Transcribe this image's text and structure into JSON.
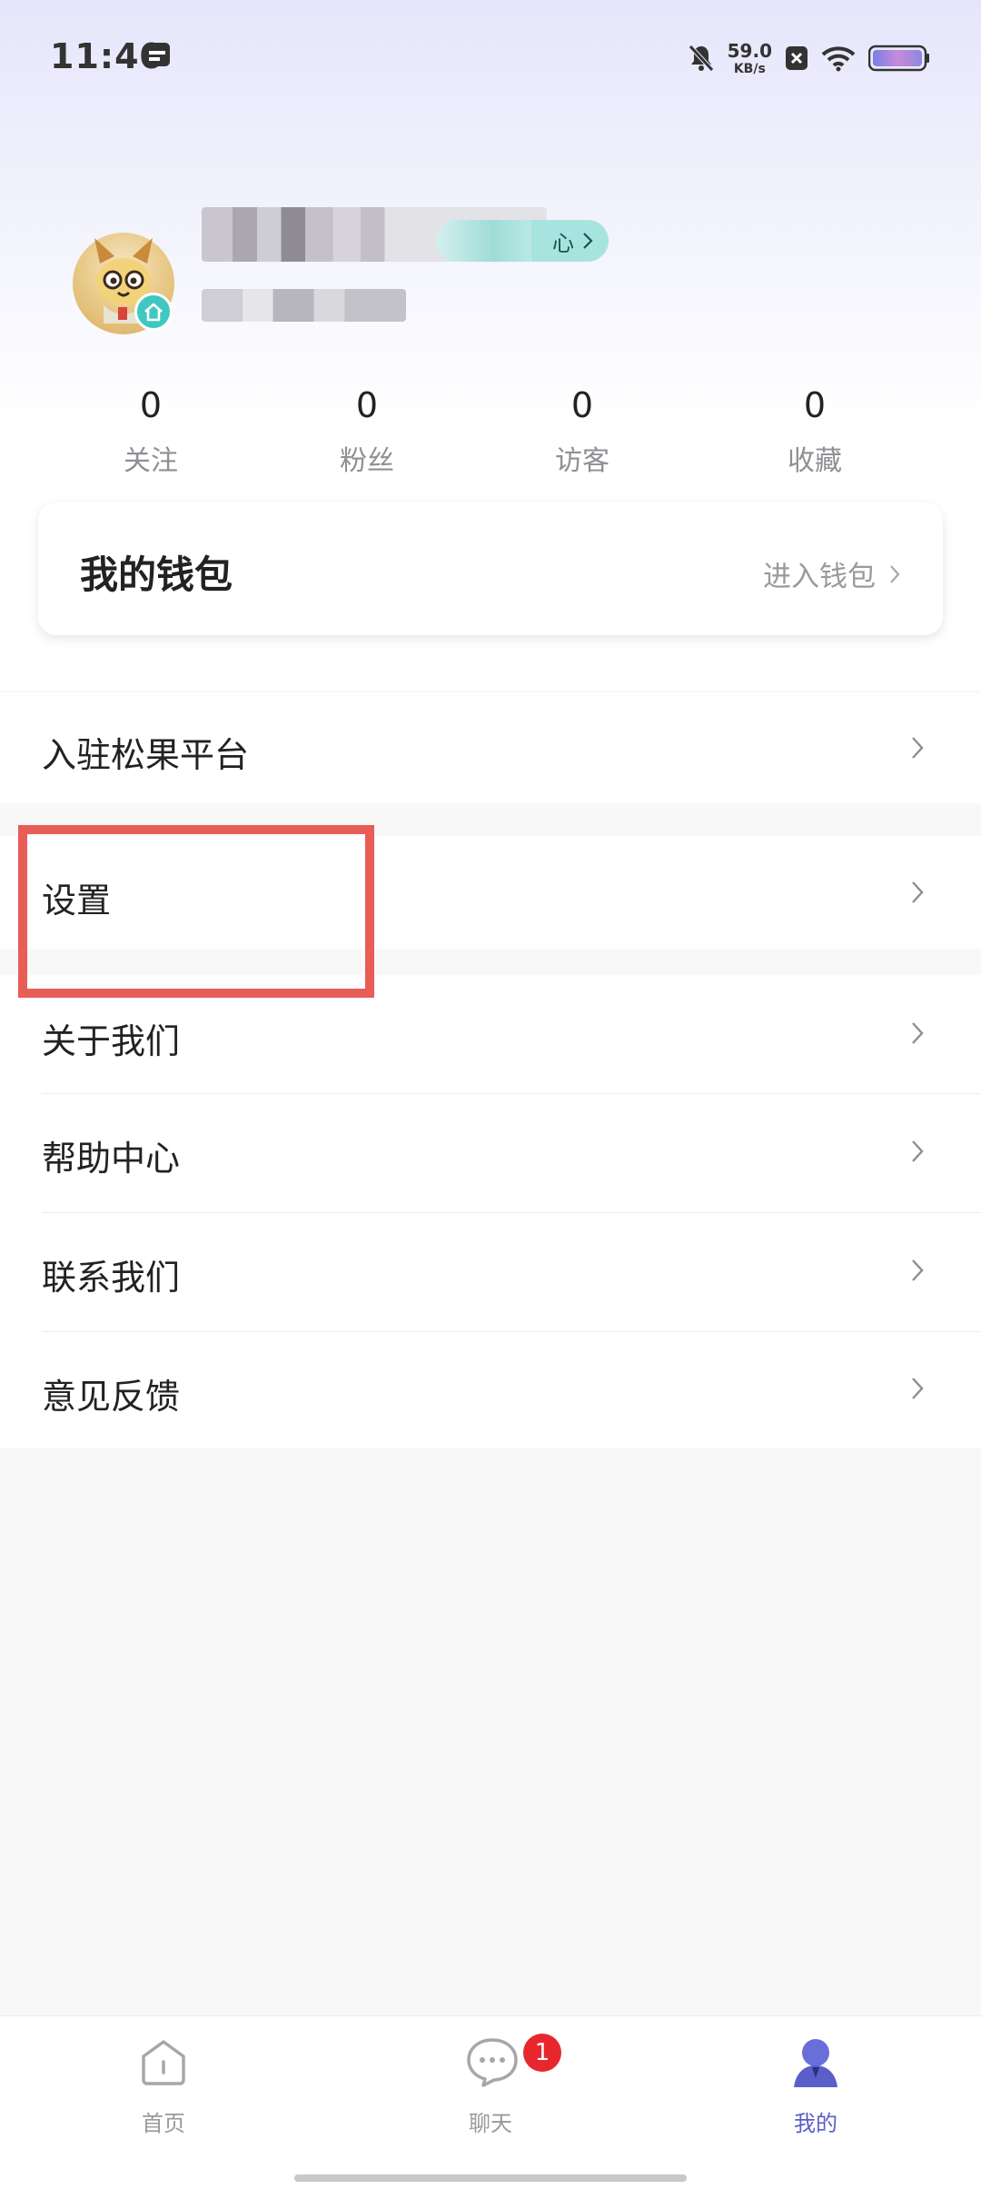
{
  "status": {
    "time": "11:40",
    "net_speed_value": "59.0",
    "net_speed_unit": "KB/s"
  },
  "profile": {
    "member_pill": "心"
  },
  "stats": [
    {
      "value": "0",
      "label": "关注"
    },
    {
      "value": "0",
      "label": "粉丝"
    },
    {
      "value": "0",
      "label": "访客"
    },
    {
      "value": "0",
      "label": "收藏"
    }
  ],
  "wallet": {
    "title": "我的钱包",
    "link": "进入钱包"
  },
  "menu": [
    {
      "label": "入驻松果平台"
    },
    {
      "label": "设置"
    },
    {
      "label": "关于我们"
    },
    {
      "label": "帮助中心"
    },
    {
      "label": "联系我们"
    },
    {
      "label": "意见反馈"
    }
  ],
  "tabs": [
    {
      "label": "首页",
      "icon": "home-icon"
    },
    {
      "label": "聊天",
      "icon": "chat-icon",
      "badge": "1"
    },
    {
      "label": "我的",
      "icon": "profile-icon",
      "active": true
    }
  ],
  "colors": {
    "accent": "#5a5ec9",
    "badge": "#e8262d",
    "highlight": "#e85d57",
    "member_pill": "#a8e4df"
  }
}
